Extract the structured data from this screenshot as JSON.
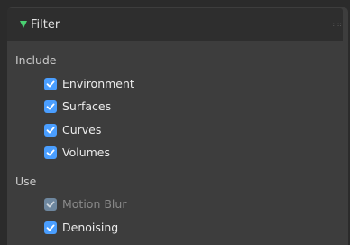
{
  "panel": {
    "title": "Filter",
    "expanded": true,
    "accent_color": "#4ad172",
    "drag_handle_glyph": "::::"
  },
  "include": {
    "label": "Include",
    "items": [
      {
        "label": "Environment",
        "checked": true,
        "enabled": true
      },
      {
        "label": "Surfaces",
        "checked": true,
        "enabled": true
      },
      {
        "label": "Curves",
        "checked": true,
        "enabled": true
      },
      {
        "label": "Volumes",
        "checked": true,
        "enabled": true
      }
    ]
  },
  "use": {
    "label": "Use",
    "items": [
      {
        "label": "Motion Blur",
        "checked": true,
        "enabled": false
      },
      {
        "label": "Denoising",
        "checked": true,
        "enabled": true
      }
    ]
  },
  "colors": {
    "checkbox_on": "#4a9eff",
    "checkbox_disabled": "#6e879f"
  }
}
